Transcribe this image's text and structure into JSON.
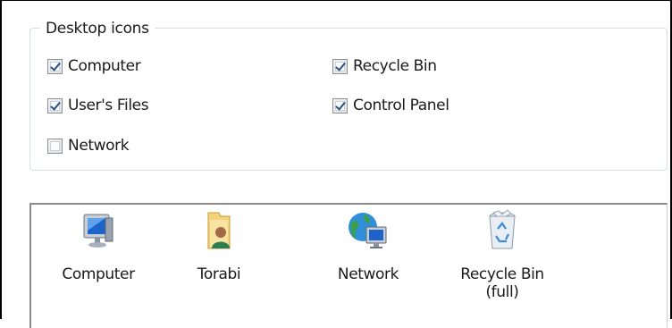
{
  "desktop_icons": {
    "group_label": "Desktop icons",
    "checkboxes": [
      {
        "label": "Computer",
        "checked": true
      },
      {
        "label": "Recycle Bin",
        "checked": true
      },
      {
        "label": "User's Files",
        "checked": true
      },
      {
        "label": "Control Panel",
        "checked": true
      },
      {
        "label": "Network",
        "checked": false
      }
    ]
  },
  "preview": {
    "icons": [
      {
        "label": "Computer",
        "icon": "computer-icon"
      },
      {
        "label": "Torabi",
        "icon": "user-folder-icon"
      },
      {
        "label": "Network",
        "icon": "network-icon"
      },
      {
        "label_line1": "Recycle Bin",
        "label_line2": "(full)",
        "icon": "recycle-bin-full-icon"
      }
    ]
  },
  "colors": {
    "check_mark": "#2a4f86",
    "group_border": "#d5dfe5"
  }
}
